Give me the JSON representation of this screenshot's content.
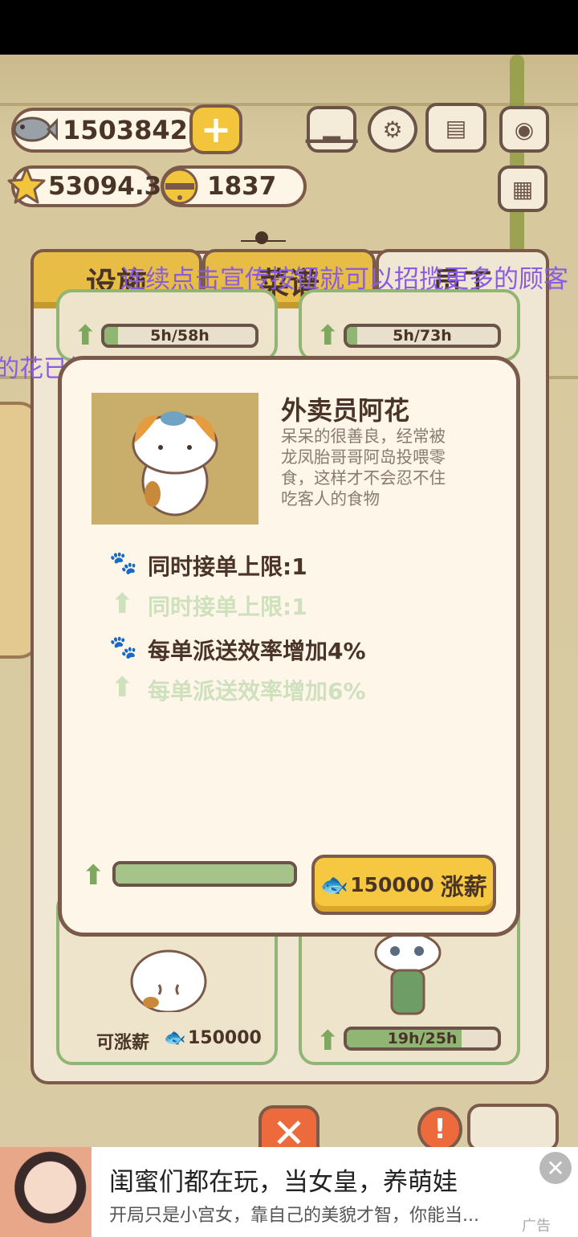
{
  "hud": {
    "fish": "1503842",
    "star": "53094.3",
    "bell": "1837",
    "plus": "+"
  },
  "tabs": [
    {
      "label": "设施",
      "active": false
    },
    {
      "label": "菜谱",
      "active": false
    },
    {
      "label": "员工",
      "active": true
    }
  ],
  "tips": {
    "line1": "连续点击宣传按钮就可以招揽更多的顾客",
    "line2": "的花已经长好啦，记得点击摘取(=^ェ^=)"
  },
  "staff_top": [
    {
      "timer": "5h/58h",
      "progress": 0.09
    },
    {
      "timer": "5h/73h",
      "progress": 0.07
    }
  ],
  "staff_bottom": [
    {
      "raise_label": "可涨薪",
      "raise_cost": "150000"
    },
    {
      "timer": "19h/25h",
      "progress": 0.76
    }
  ],
  "popup": {
    "name": "外卖员阿花",
    "desc": "呆呆的很善良，经常被龙凤胎哥哥阿岛投喂零食，这样才不会忍不住吃客人的食物",
    "stats": [
      {
        "text": "同时接单上限:1",
        "kind": "current",
        "icon": "paw-icon"
      },
      {
        "text": "同时接单上限:1",
        "kind": "next",
        "icon": "arrow-up-icon"
      },
      {
        "text": "每单派送效率增加4%",
        "kind": "current",
        "icon": "paw-icon"
      },
      {
        "text": "每单派送效率增加6%",
        "kind": "next",
        "icon": "arrow-up-icon"
      }
    ],
    "upgrade_progress": 1.0,
    "raise_cost": "150000",
    "raise_label": "涨薪"
  },
  "ad": {
    "title": "闺蜜们都在玩，当女皇，养萌娃",
    "subtitle": "开局只是小宫女，靠自己的美貌才智，你能当...",
    "tag": "广告"
  },
  "colors": {
    "brown": "#7b5a4a",
    "gold": "#f6c842",
    "green": "#91b574",
    "tip_purple": "#8a5ce0"
  }
}
